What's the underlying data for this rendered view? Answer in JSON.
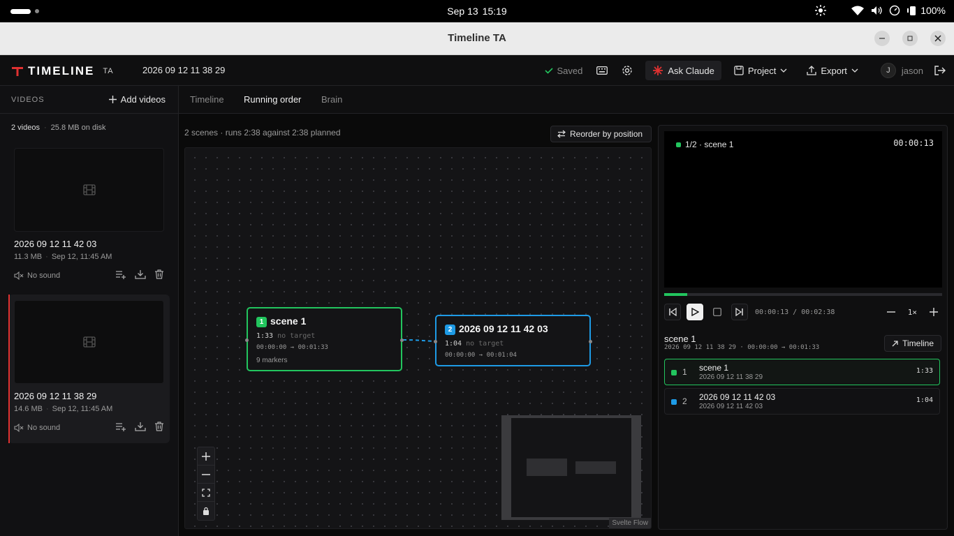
{
  "os": {
    "date": "Sep 13",
    "time": "15:19",
    "battery": "100%"
  },
  "window": {
    "title": "Timeline TA"
  },
  "header": {
    "logo_word": "TIMELINE",
    "logo_suffix": "TA",
    "project_name": "2026 09 12 11 38 29",
    "saved_label": "Saved",
    "ask_label": "Ask Claude",
    "project_label": "Project",
    "export_label": "Export",
    "user_initial": "J",
    "user_name": "jason"
  },
  "sidebar": {
    "title": "VIDEOS",
    "add_label": "Add videos",
    "count": "2 videos",
    "disk": "25.8 MB on disk",
    "videos": [
      {
        "name": "2026 09 12 11 42 03",
        "size": "11.3 MB",
        "date": "Sep 12, 11:45 AM",
        "sound": "No sound",
        "active": false
      },
      {
        "name": "2026 09 12 11 38 29",
        "size": "14.6 MB",
        "date": "Sep 12, 11:45 AM",
        "sound": "No sound",
        "active": true
      }
    ]
  },
  "tabs": [
    {
      "label": "Timeline",
      "active": false
    },
    {
      "label": "Running order",
      "active": true
    },
    {
      "label": "Brain",
      "active": false
    }
  ],
  "graph": {
    "summary": "2 scenes · runs 2:38 against 2:38 planned",
    "reorder_label": "Reorder by position",
    "attribution": "Svelte Flow",
    "nodes": [
      {
        "num": "1",
        "title": "scene 1",
        "duration": "1:33",
        "target": "no target",
        "range": "00:00:00 → 00:01:33",
        "markers": "9 markers",
        "color": "#22c55e"
      },
      {
        "num": "2",
        "title": "2026 09 12 11 42 03",
        "duration": "1:04",
        "target": "no target",
        "range": "00:00:00 → 00:01:04",
        "color": "#1e9be6"
      }
    ]
  },
  "player": {
    "position": "1/2 · scene 1",
    "timecode": "00:00:13",
    "time_readout": "00:00:13 / 00:02:38",
    "progress": 0.083,
    "speed": "1×",
    "scene_title": "scene 1",
    "scene_sub": "2026 09 12 11 38 29 · 00:00:00 → 00:01:33",
    "timeline_label": "Timeline"
  },
  "scenes": [
    {
      "index": "1",
      "name": "scene 1",
      "source": "2026 09 12 11 38 29",
      "duration": "1:33",
      "color": "#22c55e",
      "selected": true
    },
    {
      "index": "2",
      "name": "2026 09 12 11 42 03",
      "source": "2026 09 12 11 42 03",
      "duration": "1:04",
      "color": "#1e9be6",
      "selected": false
    }
  ]
}
